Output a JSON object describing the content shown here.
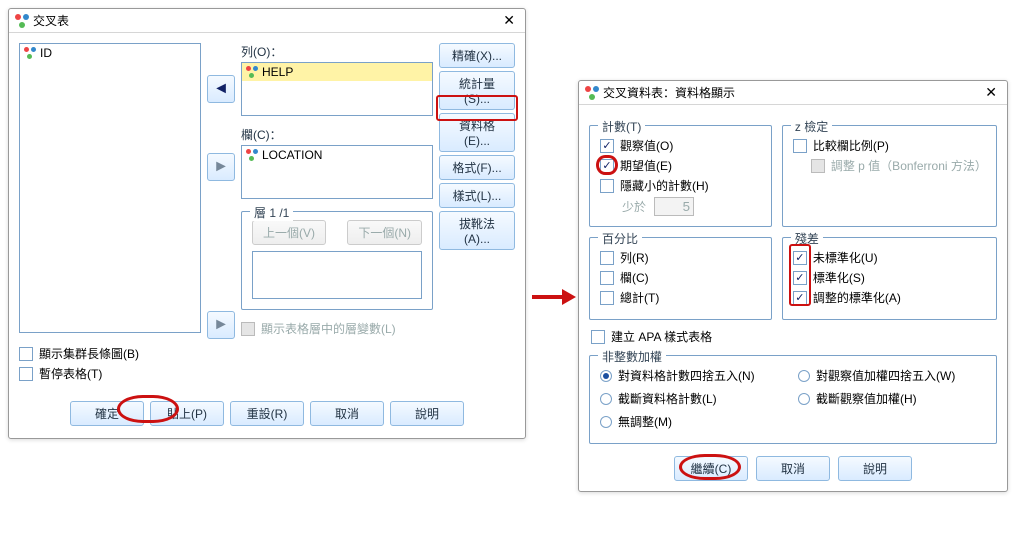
{
  "dlg1": {
    "title": "交叉表",
    "id_label": "ID",
    "col_label": "列(O)：",
    "row_label": "欄(C)：",
    "help_item": "HELP",
    "location_item": "LOCATION",
    "layer_label": "層 1 /1",
    "prev_layer": "上一個(V)",
    "next_layer": "下一個(N)",
    "show_layers_cb": "顯示表格層中的層變數(L)",
    "show_cluster_cb": "顯示集群長條圖(B)",
    "suppress_tables_cb": "暫停表格(T)",
    "side_buttons": [
      "精確(X)...",
      "統計量(S)...",
      "資料格(E)...",
      "格式(F)...",
      "樣式(L)...",
      "拔靴法(A)..."
    ],
    "bottom_buttons": [
      "確定",
      "貼上(P)",
      "重設(R)",
      "取消",
      "說明"
    ]
  },
  "dlg2": {
    "title": "交叉資料表：資料格顯示",
    "groups": {
      "counts": "計數(T)",
      "ztest": "z 檢定",
      "percent": "百分比",
      "resid": "殘差",
      "nonint": "非整數加權"
    },
    "counts": {
      "observed": "觀察值(O)",
      "expected": "期望值(E)",
      "hide_small": "隱藏小的計數(H)",
      "less_than": "少於",
      "less_than_val": "5"
    },
    "ztest": {
      "compare": "比較欄比例(P)",
      "adjust": "調整 p 值（Bonferroni 方法）"
    },
    "percent": {
      "row": "列(R)",
      "col": "欄(C)",
      "total": "總計(T)"
    },
    "resid": {
      "unstd": "未標準化(U)",
      "std": "標準化(S)",
      "adjstd": "調整的標準化(A)"
    },
    "apa_cb": "建立 APA 樣式表格",
    "nonint": {
      "r1": "對資料格計數四捨五入(N)",
      "r2": "對觀察值加權四捨五入(W)",
      "r3": "截斷資料格計數(L)",
      "r4": "截斷觀察值加權(H)",
      "r5": "無調整(M)"
    },
    "bottom_buttons": [
      "繼續(C)",
      "取消",
      "說明"
    ]
  }
}
